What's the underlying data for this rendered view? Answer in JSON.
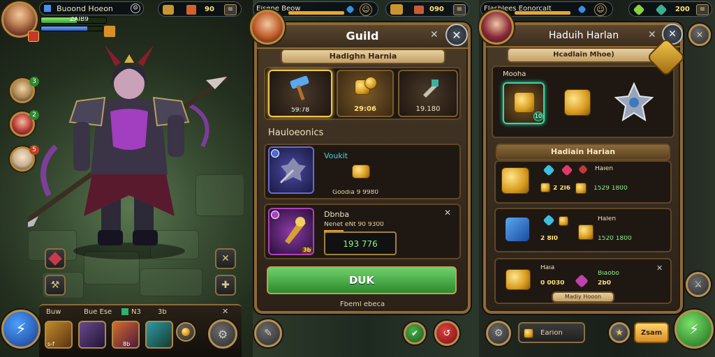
{
  "left": {
    "player_name": "Buoond Hoeon",
    "hp_text": "ZAIB9",
    "res_count_1": "90",
    "party_badges": [
      "3",
      "2",
      "5"
    ],
    "hp_fraction": 0.55,
    "xp_fraction": 0.75,
    "skillbar": {
      "label_a": "Buw",
      "label_b": "Bue Ese",
      "label_c": "N3",
      "label_d": "3b",
      "slots": [
        "s-f",
        "8b",
        "",
        ""
      ]
    }
  },
  "middle": {
    "player_name": "Eisene Beow",
    "res_count": "090",
    "title": "Guild",
    "subtitle": "Hadighn Harnia",
    "top_rewards": [
      {
        "value": "59:78"
      },
      {
        "value": "29:06"
      },
      {
        "value": "19.180"
      }
    ],
    "section_title": "Hauloeonics",
    "item1": {
      "name": "Voukit",
      "cost": "Goodia 9 9980"
    },
    "item2": {
      "name": "Dbnba",
      "desc": "Nenet eNt 90 9300",
      "price": "193 776",
      "level": "3b"
    },
    "main_button": "DUK",
    "footer": "Fbeml ebeca"
  },
  "right": {
    "player_name": "Flashlees Eonorcalt",
    "res_count": "200",
    "title": "Haduih Harlan",
    "subtitle": "Hcadlain Mhoe)",
    "top_label": "Mooha",
    "top_badge": "10",
    "section_title": "Hadiain Harian",
    "rows": [
      {
        "name": "Haien",
        "amount": "2 2l6",
        "score": "1529 1800"
      },
      {
        "name": "Halen",
        "amount": "2 8l0",
        "score": "1520 1800"
      },
      {
        "name": "Haia",
        "amount": "0 0030",
        "score": "2b0",
        "name2": "Biaobo"
      }
    ],
    "tag_label": "Madiy Hooon",
    "bottom_label": "Earion",
    "bottom_btn": "Zsam"
  },
  "colors": {
    "accent_gold": "#f0c64a",
    "accent_green": "#4fbf4a",
    "panel_brown": "#4a3a28"
  }
}
